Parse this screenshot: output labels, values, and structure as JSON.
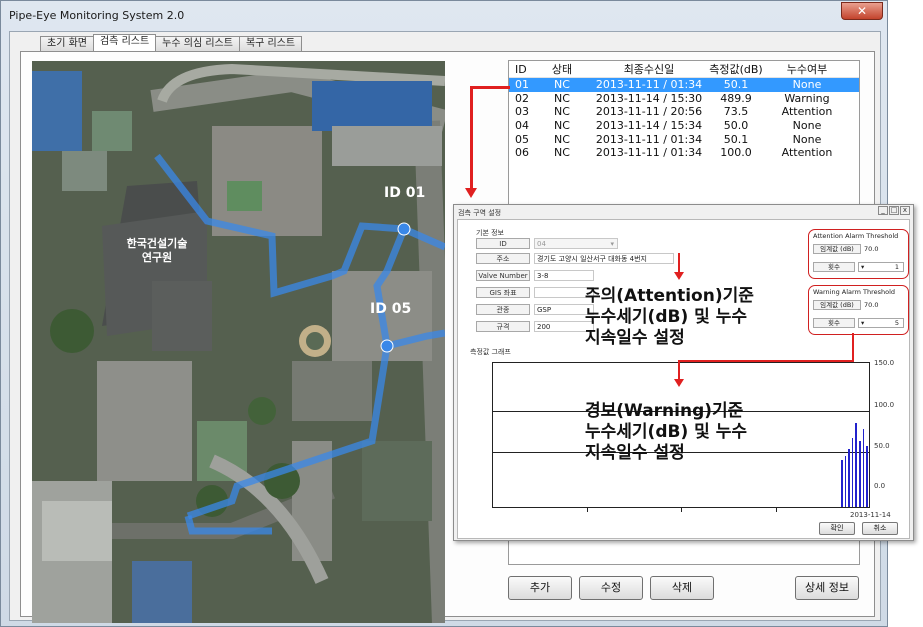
{
  "window": {
    "title": "Pipe-Eye Monitoring System 2.0",
    "close_glyph": "✕"
  },
  "tabs": [
    {
      "label": "초기 화면",
      "active": false
    },
    {
      "label": "검측 리스트",
      "active": true
    },
    {
      "label": "누수 의심 리스트",
      "active": false
    },
    {
      "label": "복구 리스트",
      "active": false
    }
  ],
  "map": {
    "labels": {
      "id01": "ID 01",
      "id05": "ID 05",
      "building": "한국건설기술\n연구원"
    }
  },
  "list": {
    "columns": [
      "ID",
      "상태",
      "최종수신일",
      "측정값(dB)",
      "누수여부"
    ],
    "rows": [
      {
        "id": "01",
        "status": "NC",
        "date": "2013-11-11 / 01:34",
        "value": "50.1",
        "leak": "None",
        "selected": true
      },
      {
        "id": "02",
        "status": "NC",
        "date": "2013-11-14 / 15:30",
        "value": "489.9",
        "leak": "Warning"
      },
      {
        "id": "03",
        "status": "NC",
        "date": "2013-11-11 / 20:56",
        "value": "73.5",
        "leak": "Attention"
      },
      {
        "id": "04",
        "status": "NC",
        "date": "2013-11-14 / 15:34",
        "value": "50.0",
        "leak": "None"
      },
      {
        "id": "05",
        "status": "NC",
        "date": "2013-11-11 / 01:34",
        "value": "50.1",
        "leak": "None"
      },
      {
        "id": "06",
        "status": "NC",
        "date": "2013-11-11 / 01:34",
        "value": "100.0",
        "leak": "Attention"
      }
    ]
  },
  "buttons": {
    "add": "추가",
    "edit": "수정",
    "delete": "삭제",
    "detail": "상세 정보"
  },
  "dialog": {
    "title": "검측 구역 설정",
    "basic_info_label": "기본 정보",
    "fields": [
      {
        "label": "ID",
        "value": "04"
      },
      {
        "label": "주소",
        "value": "경기도 고양시 일산서구 대화동 4번지"
      },
      {
        "label": "Valve Number",
        "value": "3-8"
      },
      {
        "label": "GIS 좌표",
        "value": ""
      },
      {
        "label": "관종",
        "value": "GSP"
      },
      {
        "label": "규격",
        "value": "200"
      }
    ],
    "attention": {
      "title": "Attention Alarm Threshold",
      "threshold_label": "임계값 (dB)",
      "threshold_value": "70.0",
      "count_label": "횟수",
      "count_value": "1"
    },
    "warning": {
      "title": "Warning Alarm Threshold",
      "threshold_label": "임계값 (dB)",
      "threshold_value": "70.0",
      "count_label": "횟수",
      "count_value": "5"
    },
    "graph_label": "측정값 그래프",
    "graph": {
      "y_ticks": [
        "150.0",
        "100.0",
        "50.0",
        "0.0"
      ],
      "x_label": "2013-11-14",
      "bars": [
        48,
        52,
        60,
        71,
        86,
        68,
        80,
        63
      ]
    },
    "ok": "확인",
    "cancel": "취소"
  },
  "annotations": {
    "attention": [
      "주의(Attention)기준",
      "누수세기(dB) 및 누수",
      "지속일수 설정"
    ],
    "warning": [
      "경보(Warning)기준",
      "누수세기(dB) 및 누수",
      "지속일수 설정"
    ]
  },
  "colors": {
    "accent_red": "#e02020",
    "selection": "#3399ff",
    "bars": "#2222cc",
    "route": "#3a88e8"
  }
}
